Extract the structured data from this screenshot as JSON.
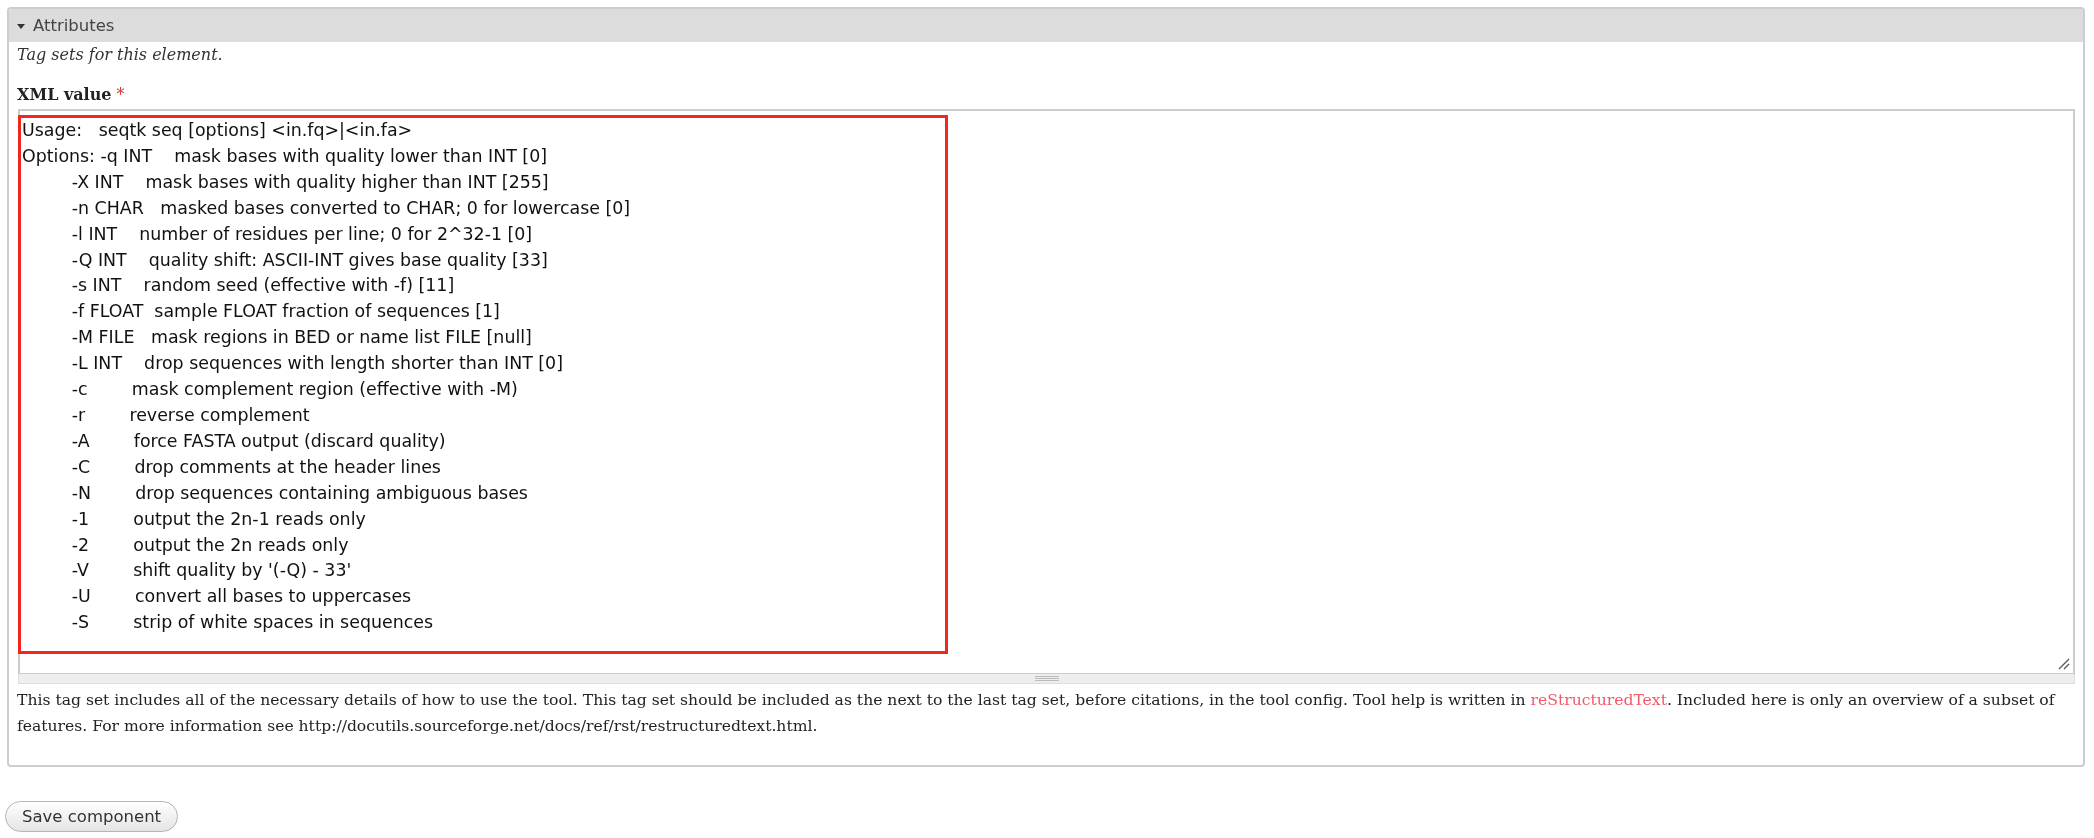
{
  "fieldset": {
    "title": "Attributes",
    "expanded": true,
    "description": "Tag sets for this element.",
    "field": {
      "label": "XML value",
      "required_mark": "*",
      "highlighted": true,
      "lines": [
        "Usage:   seqtk seq [options] <in.fq>|<in.fa>",
        "Options: -q INT    mask bases with quality lower than INT [0]",
        "         -X INT    mask bases with quality higher than INT [255]",
        "         -n CHAR   masked bases converted to CHAR; 0 for lowercase [0]",
        "         -l INT    number of residues per line; 0 for 2^32-1 [0]",
        "         -Q INT    quality shift: ASCII-INT gives base quality [33]",
        "         -s INT    random seed (effective with -f) [11]",
        "         -f FLOAT  sample FLOAT fraction of sequences [1]",
        "         -M FILE   mask regions in BED or name list FILE [null]",
        "         -L INT    drop sequences with length shorter than INT [0]",
        "         -c        mask complement region (effective with -M)",
        "         -r        reverse complement",
        "         -A        force FASTA output (discard quality)",
        "         -C        drop comments at the header lines",
        "         -N        drop sequences containing ambiguous bases",
        "         -1        output the 2n-1 reads only",
        "         -2        output the 2n reads only",
        "         -V        shift quality by '(-Q) - 33'",
        "         -U        convert all bases to uppercases",
        "         -S        strip of white spaces in sequences"
      ]
    },
    "help": [
      {
        "kind": "text",
        "text": "This tag set includes all of the necessary details of how to use the tool. This tag set should be included as the next to the last tag set, before citations, in the tool config. Tool help is written in "
      },
      {
        "kind": "link",
        "text": "reStructuredText"
      },
      {
        "kind": "text",
        "text": ". Included here is only an overview of a subset of features. For more information see http://docutils.sourceforge.net/docs/ref/rst/restructuredtext.html."
      }
    ]
  },
  "button": {
    "label": "Save component"
  }
}
